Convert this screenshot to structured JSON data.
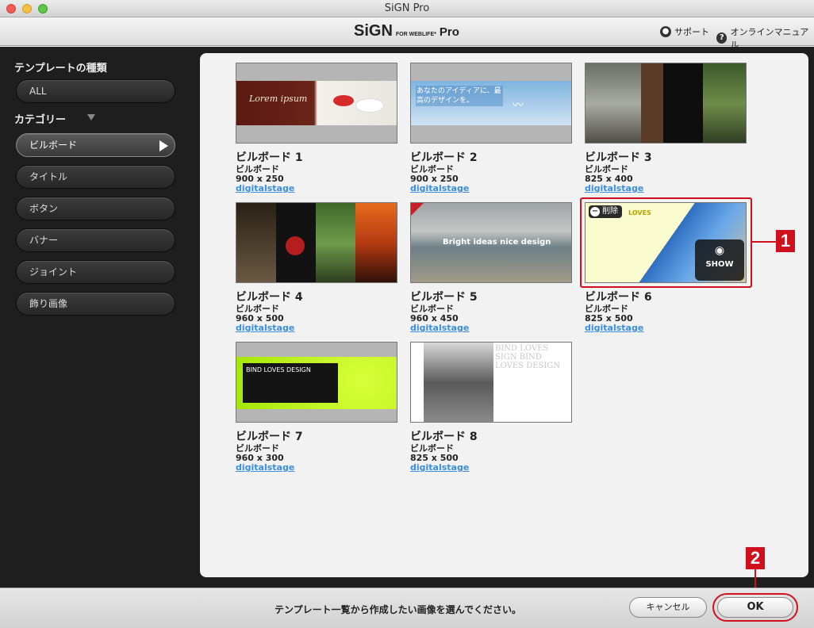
{
  "window": {
    "title": "SiGN Pro"
  },
  "header": {
    "logo_main": "SiGN",
    "logo_sub": "FOR WEBLIFE*",
    "logo_pro": "Pro",
    "support_label": "サポート",
    "manual_label": "オンラインマニュアル",
    "support_icon": "person-icon",
    "manual_icon": "question-icon"
  },
  "sidebar": {
    "heading": "テンプレートの種類",
    "all_label": "ALL",
    "category_heading": "カテゴリー",
    "items": [
      {
        "label": "ビルボード",
        "active": true
      },
      {
        "label": "タイトル"
      },
      {
        "label": "ボタン"
      },
      {
        "label": "バナー"
      },
      {
        "label": "ジョイント"
      },
      {
        "label": "飾り画像"
      }
    ]
  },
  "templates": [
    {
      "title": "ビルボード 1",
      "category": "ビルボード",
      "size": "900 x 250",
      "author": "digitalstage",
      "thumb_text": "Lorem ipsum"
    },
    {
      "title": "ビルボード 2",
      "category": "ビルボード",
      "size": "900 x 250",
      "author": "digitalstage",
      "thumb_text": "あなたのアイディアに、最高のデザインを。"
    },
    {
      "title": "ビルボード 3",
      "category": "ビルボード",
      "size": "825 x 400",
      "author": "digitalstage"
    },
    {
      "title": "ビルボード 4",
      "category": "ビルボード",
      "size": "960 x 500",
      "author": "digitalstage"
    },
    {
      "title": "ビルボード 5",
      "category": "ビルボード",
      "size": "960 x 450",
      "author": "digitalstage",
      "thumb_text": "Bright ideas nice design"
    },
    {
      "title": "ビルボード 6",
      "category": "ビルボード",
      "size": "825 x 500",
      "author": "digitalstage",
      "thumb_text": "LOVES"
    },
    {
      "title": "ビルボード 7",
      "category": "ビルボード",
      "size": "960 x 300",
      "author": "digitalstage",
      "thumb_text": "BIND LOVES DESIGN"
    },
    {
      "title": "ビルボード 8",
      "category": "ビルボード",
      "size": "825 x 500",
      "author": "digitalstage",
      "thumb_text": "BIND LOVES SIGN BIND LOVES DESIGN"
    }
  ],
  "card_overlay": {
    "delete_label": "削除",
    "show_label": "SHOW"
  },
  "callouts": {
    "one": "1",
    "two": "2"
  },
  "footer": {
    "instruction": "テンプレート一覧から作成したい画像を選んでください。",
    "cancel_label": "キャンセル",
    "ok_label": "OK"
  },
  "colors": {
    "accent_red": "#d1101d",
    "link_blue": "#3a8dde",
    "sidebar_bg": "#1e1e1e"
  }
}
